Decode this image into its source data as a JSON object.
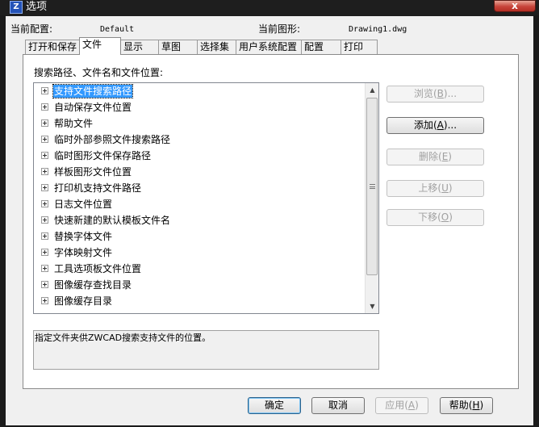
{
  "window": {
    "title": "选项",
    "app_icon": "drawing-app-icon",
    "close_label": "x"
  },
  "header": {
    "current_profile_label": "当前配置:",
    "current_profile_value": "Default",
    "current_drawing_label": "当前图形:",
    "current_drawing_value": "Drawing1.dwg"
  },
  "tabs": [
    {
      "label": "打开和保存"
    },
    {
      "label": "文件"
    },
    {
      "label": "显示"
    },
    {
      "label": "草图"
    },
    {
      "label": "选择集"
    },
    {
      "label": "用户系统配置"
    },
    {
      "label": "配置"
    },
    {
      "label": "打印"
    }
  ],
  "active_tab": "文件",
  "files_panel": {
    "tree_label": "搜索路径、文件名和文件位置:",
    "items": [
      {
        "label": "支持文件搜索路径",
        "selected": true
      },
      {
        "label": "自动保存文件位置"
      },
      {
        "label": "帮助文件"
      },
      {
        "label": "临时外部参照文件搜索路径"
      },
      {
        "label": "临时图形文件保存路径"
      },
      {
        "label": "样板图形文件位置"
      },
      {
        "label": "打印机支持文件路径"
      },
      {
        "label": "日志文件位置"
      },
      {
        "label": "快速新建的默认模板文件名"
      },
      {
        "label": "替换字体文件"
      },
      {
        "label": "字体映射文件"
      },
      {
        "label": "工具选项板文件位置"
      },
      {
        "label": "图像缓存查找目录"
      },
      {
        "label": "图像缓存目录"
      }
    ],
    "description": "指定文件夹供ZWCAD搜索支持文件的位置。",
    "buttons": {
      "browse": {
        "label": "浏览",
        "key": "B",
        "suffix": "..."
      },
      "add": {
        "label": "添加",
        "key": "A",
        "suffix": "..."
      },
      "delete": {
        "label": "删除",
        "key": "E",
        "suffix": ""
      },
      "move_up": {
        "label": "上移",
        "key": "U",
        "suffix": ""
      },
      "move_down": {
        "label": "下移",
        "key": "O",
        "suffix": ""
      }
    }
  },
  "footer": {
    "ok": "确定",
    "cancel": "取消",
    "apply": {
      "label": "应用",
      "key": "A"
    },
    "help": {
      "label": "帮助",
      "key": "H"
    }
  },
  "colors": {
    "selection": "#3399ff",
    "dialog_bg": "#f0f0f0",
    "close_button": "#c7443a"
  }
}
